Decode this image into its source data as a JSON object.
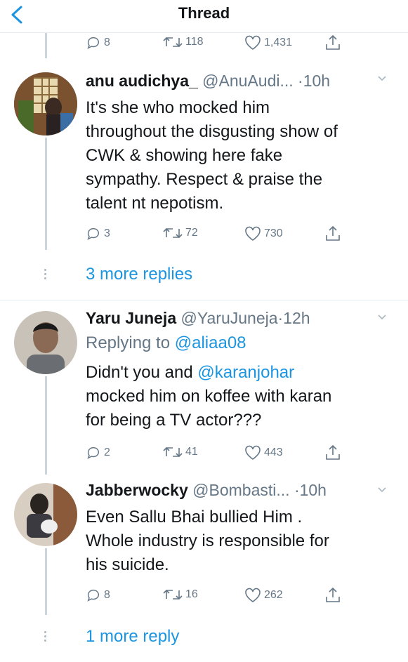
{
  "header": {
    "title": "Thread"
  },
  "top_actions": {
    "replies": "8",
    "retweets": "118",
    "likes": "1,431"
  },
  "tweets": [
    {
      "name": "anu audichya_",
      "handle": "@AnuAudi...",
      "time": "·10h",
      "lines": [
        "It's she who mocked him",
        "throughout the disgusting show of",
        "CWK & showing here fake",
        "sympathy. Respect & praise the",
        "talent nt nepotism."
      ],
      "replies": "3",
      "retweets": "72",
      "likes": "730"
    },
    {
      "name": "Yaru Juneja",
      "handle": "@YaruJuneja",
      "time": "·12h",
      "replying_prefix": "Replying to ",
      "replying_to": "@aliaa08",
      "line1_prefix": "Didn't you and ",
      "line1_mention": "@karanjohar",
      "line2": "mocked him on koffee with karan",
      "line3": "for being a TV actor???",
      "replies": "2",
      "retweets": "41",
      "likes": "443"
    },
    {
      "name": "Jabberwocky",
      "handle": "@Bombasti...",
      "time": "·10h",
      "lines": [
        "Even Sallu Bhai bullied Him .",
        "Whole industry is responsible for",
        "his suicide."
      ],
      "replies": "8",
      "retweets": "16",
      "likes": "262"
    }
  ],
  "more_replies_1": "3 more replies",
  "more_replies_2": "1 more reply",
  "colors": {
    "accent": "#1b95e0",
    "secondary": "#657786",
    "divider": "#e6ecf0"
  }
}
